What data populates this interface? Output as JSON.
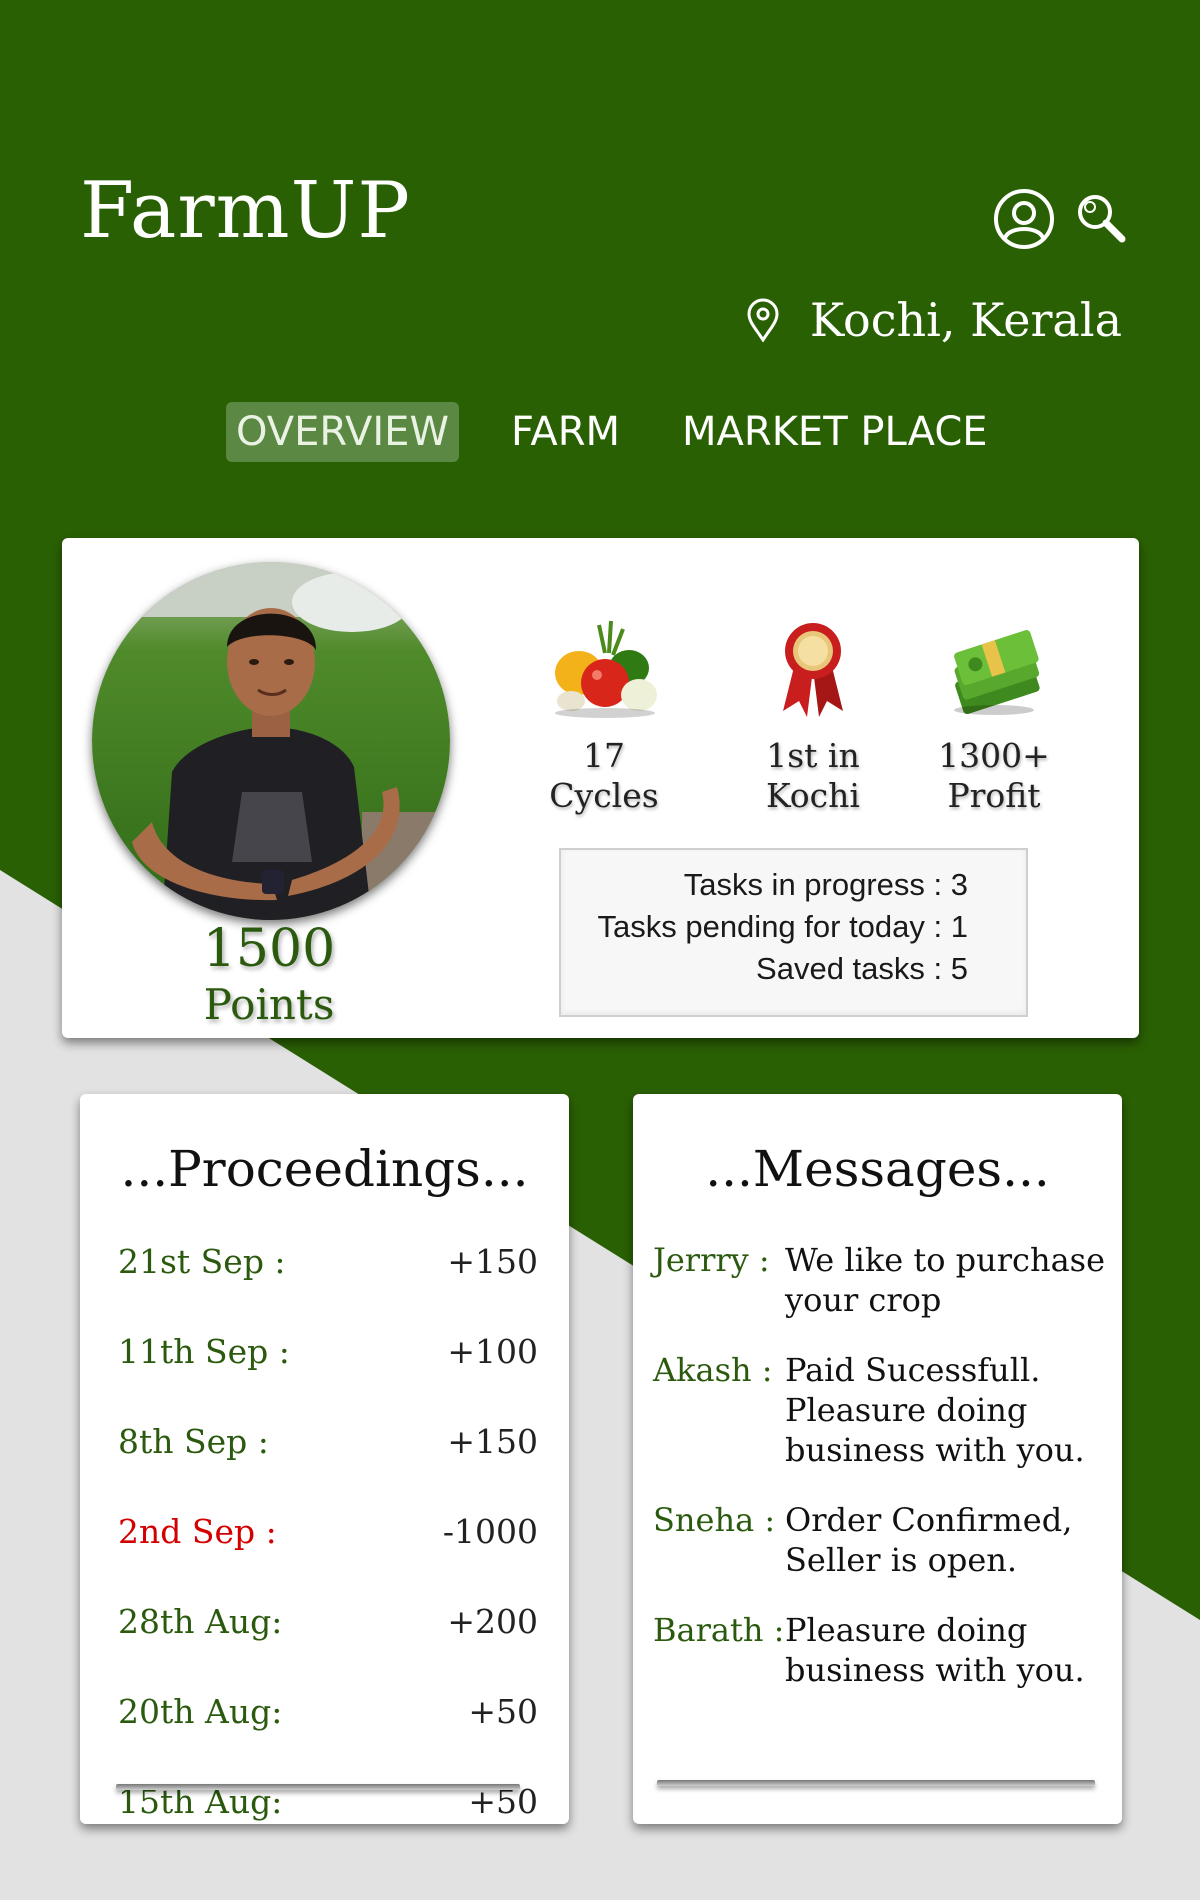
{
  "header": {
    "title": "FarmUP",
    "location": "Kochi, Kerala",
    "icons": [
      "user-icon",
      "search-icon",
      "location-pin-icon"
    ]
  },
  "tabs": [
    {
      "label": "OVERVIEW",
      "active": true
    },
    {
      "label": "FARM",
      "active": false
    },
    {
      "label": "MARKET PLACE",
      "active": false
    }
  ],
  "profile": {
    "points_value": "1500",
    "points_label": "Points",
    "stats": [
      {
        "line1": "17",
        "line2": "Cycles",
        "icon": "vegetables-icon"
      },
      {
        "line1": "1st in",
        "line2": "Kochi",
        "icon": "award-ribbon-icon"
      },
      {
        "line1": "1300+",
        "line2": "Profit",
        "icon": "money-stack-icon"
      }
    ],
    "tasks": [
      "Tasks in progress : 3",
      "Tasks pending for today : 1",
      "Saved tasks : 5"
    ]
  },
  "proceedings": {
    "title": "...Proceedings...",
    "items": [
      {
        "date": "21st Sep :",
        "amount": "+150",
        "negative": false
      },
      {
        "date": "11th Sep :",
        "amount": "+100",
        "negative": false
      },
      {
        "date": "8th Sep  :",
        "amount": "+150",
        "negative": false
      },
      {
        "date": "2nd Sep :",
        "amount": "-1000",
        "negative": true
      },
      {
        "date": "28th Aug:",
        "amount": "+200",
        "negative": false
      },
      {
        "date": "20th Aug:",
        "amount": "+50",
        "negative": false
      },
      {
        "date": "15th Aug:",
        "amount": "+50",
        "negative": false
      }
    ]
  },
  "messages": {
    "title": "...Messages...",
    "items": [
      {
        "sender": "Jerrry :",
        "text": "We like to purchase your crop"
      },
      {
        "sender": "Akash  :",
        "text": "Paid Sucessfull. Pleasure doing business with you."
      },
      {
        "sender": "Sneha :",
        "text": "Order Confirmed, Seller is open."
      },
      {
        "sender": "Barath :",
        "text": "Pleasure doing business with you."
      }
    ]
  },
  "colors": {
    "header_green": "#2a6004",
    "accent_text_green": "#2b5a0f",
    "active_tab": "#5b8842",
    "negative": "#d40000",
    "background_grey": "#e2e2e2"
  }
}
